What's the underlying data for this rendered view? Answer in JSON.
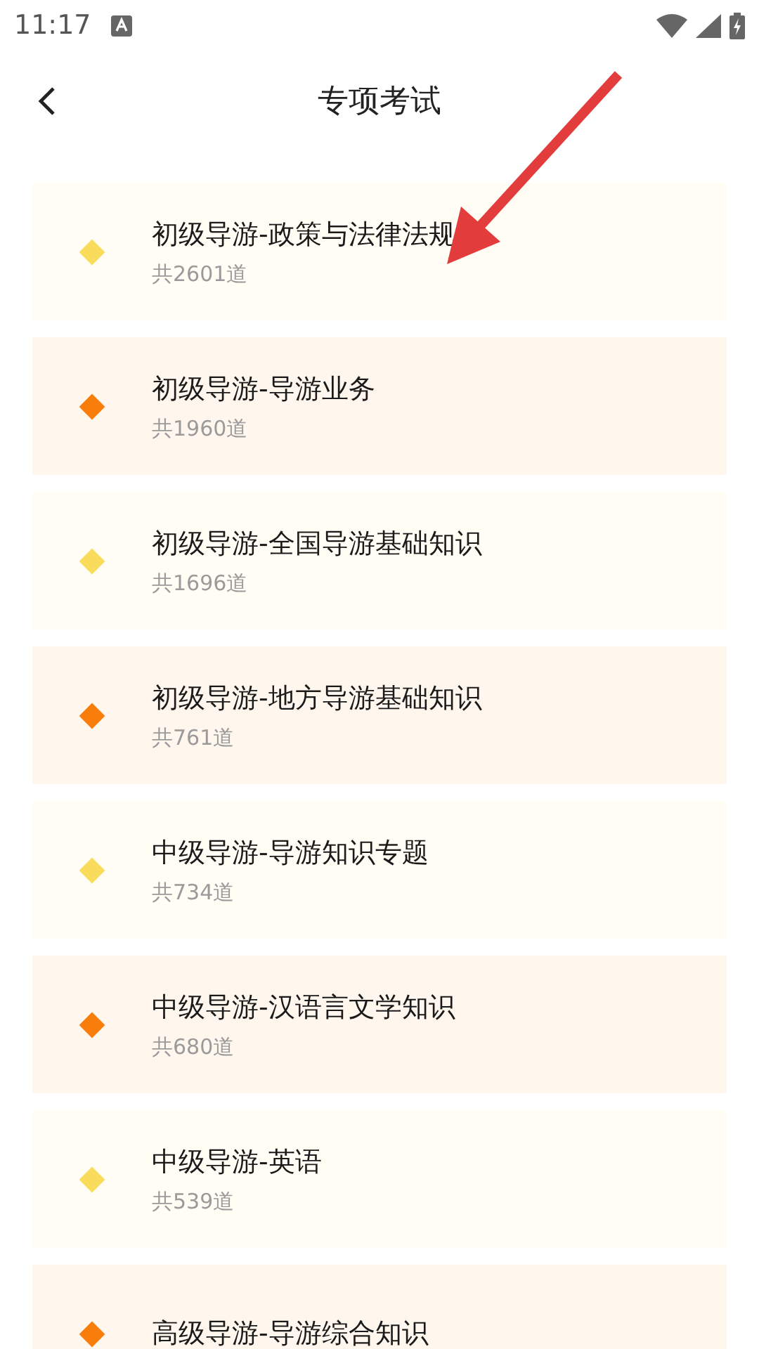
{
  "status_bar": {
    "time": "11:17"
  },
  "header": {
    "title": "专项考试"
  },
  "exams": [
    {
      "title": "初级导游-政策与法律法规",
      "count": "共2601道",
      "color": "#f9dc5c"
    },
    {
      "title": "初级导游-导游业务",
      "count": "共1960道",
      "color": "#f97d0b"
    },
    {
      "title": "初级导游-全国导游基础知识",
      "count": "共1696道",
      "color": "#f9dc5c"
    },
    {
      "title": "初级导游-地方导游基础知识",
      "count": "共761道",
      "color": "#f97d0b"
    },
    {
      "title": "中级导游-导游知识专题",
      "count": "共734道",
      "color": "#f9dc5c"
    },
    {
      "title": "中级导游-汉语言文学知识",
      "count": "共680道",
      "color": "#f97d0b"
    },
    {
      "title": "中级导游-英语",
      "count": "共539道",
      "color": "#f9dc5c"
    },
    {
      "title": "高级导游-导游综合知识",
      "color": "#f97d0b"
    }
  ]
}
